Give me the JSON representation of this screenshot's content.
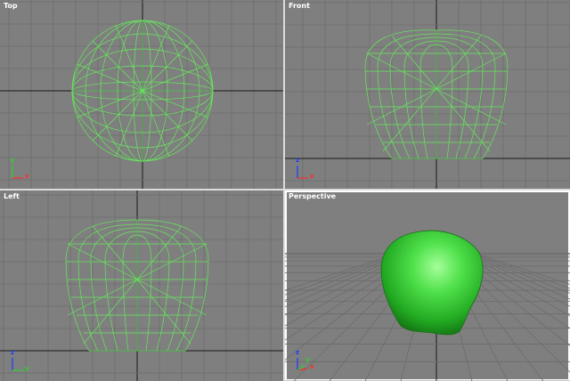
{
  "viewports": {
    "top": {
      "label": "Top"
    },
    "front": {
      "label": "Front"
    },
    "left": {
      "label": "Left"
    },
    "perspective": {
      "label": "Perspective"
    }
  },
  "axes": {
    "top": {
      "v": "y",
      "h": "x"
    },
    "front": {
      "v": "z",
      "h": "x"
    },
    "left": {
      "v": "z",
      "h": "y"
    },
    "perspective": {
      "v": "z",
      "h": "x",
      "d": "y"
    }
  },
  "colors": {
    "viewport_bg": "#7f7f7f",
    "grid_line": "#6c6c6c",
    "grid_axis": "#1a1a1a",
    "wireframe": "#66e85c",
    "shaded_object": "#3cc43c",
    "active_border": "#ffffff",
    "frame_bg": "#dcdcdc"
  }
}
